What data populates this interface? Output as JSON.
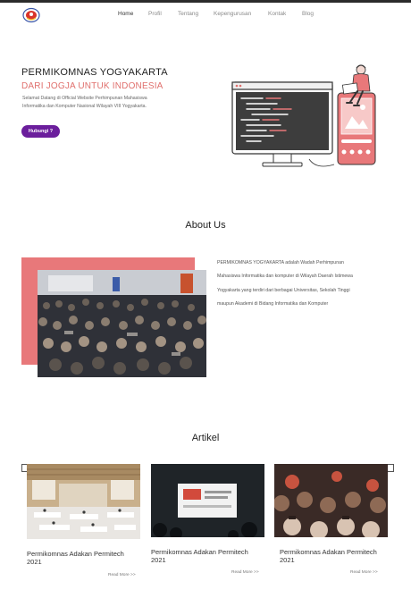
{
  "nav": {
    "items": [
      {
        "label": "Home",
        "active": true
      },
      {
        "label": "Profil",
        "active": false
      },
      {
        "label": "Tentang",
        "active": false
      },
      {
        "label": "Kepengurusan",
        "active": false
      },
      {
        "label": "Kontak",
        "active": false
      },
      {
        "label": "Blog",
        "active": false
      }
    ]
  },
  "hero": {
    "title": "PERMIKOMNAS YOGYAKARTA",
    "subtitle": "DARI JOGJA UNTUK INDONESIA",
    "description": "Selamat Datang di Official Website Perhimpunan Mahasiswa Informatika dan Komputer Nasional Wilayah VIII Yogyakarta.",
    "button_label": "Hubungi ?"
  },
  "about": {
    "heading": "About Us",
    "text": "PERMIKOMNAS YOGYAKARTA adalah Wadah Perhimpunan Mahasiswa Informatika dan komputer di Wilayah Daerah Istimewa Yogyakarta yang terdiri dari berbagai Universitas, Sekolah Tinggi maupun Akademi di Bidang Informatika dan Komputer"
  },
  "articles": {
    "heading": "Artikel",
    "cards": [
      {
        "title": "Permikomnas Adakan Permitech 2021",
        "read_more": "Read More >>"
      },
      {
        "title": "Permikomnas Adakan Permitech 2021",
        "read_more": "Read More >>"
      },
      {
        "title": "Permikomnas Adakan Permitech 2021",
        "read_more": "Read More >>"
      }
    ]
  },
  "colors": {
    "accent": "#e0706d",
    "button": "#6b1e9c",
    "about_block": "#e8787a"
  }
}
